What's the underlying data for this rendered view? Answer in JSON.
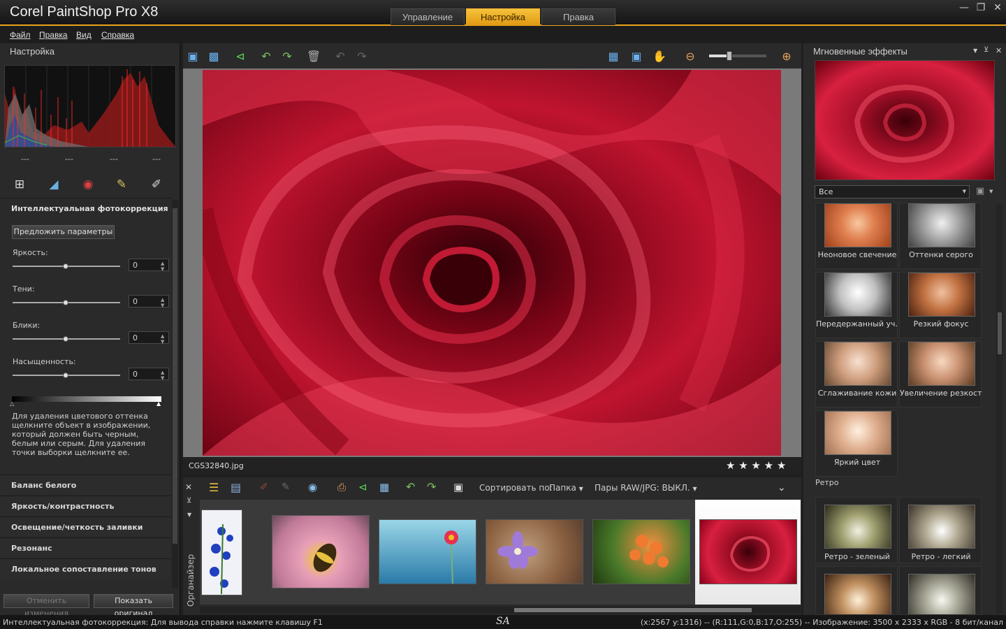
{
  "app": {
    "title": "Corel PaintShop Pro X8",
    "workspace_tabs": [
      "Управление",
      "Настройка",
      "Правка"
    ],
    "active_tab": "Настройка"
  },
  "menu": [
    "Файл",
    "Правка",
    "Вид",
    "Справка"
  ],
  "left_panel": {
    "title": "Настройка",
    "histogram_values": [
      "---",
      "---",
      "---",
      "---"
    ],
    "tools": [
      "crop-icon",
      "straighten-icon",
      "red-eye-icon",
      "retouch-icon",
      "makeover-icon"
    ],
    "smart_fix": {
      "title": "Интеллектуальная фотокоррекция",
      "suggest_button": "Предложить параметры",
      "sliders": [
        {
          "label": "Яркость:",
          "value": "0",
          "level": 0.5
        },
        {
          "label": "Тени:",
          "value": "0",
          "level": 0.5
        },
        {
          "label": "Блики:",
          "value": "0",
          "level": 0.5
        },
        {
          "label": "Насыщенность:",
          "value": "0",
          "level": 0.5
        }
      ],
      "help_text": "Для удаления цветового оттенка щелкните объект в изображении, который должен быть черным, белым или серым. Для удаления точки выборки щелкните ее."
    },
    "sections": [
      "Баланс белого",
      "Яркость/контрастность",
      "Освещение/четкость заливки",
      "Резонанс",
      "Локальное сопоставление тонов"
    ],
    "undo_button": "Отменить изменения",
    "show_original_button": "Показать оригинал"
  },
  "toolbar": {
    "icons": [
      "save-icon",
      "save-as-icon",
      "share-icon",
      "rotate-left-icon",
      "rotate-right-icon",
      "delete-icon",
      "undo-icon",
      "redo-icon"
    ],
    "view_icons": [
      "actual-size-icon",
      "fit-window-icon",
      "pan-hand-icon",
      "zoom-out-icon",
      "zoom-in-icon"
    ],
    "zoom_level": 0.35
  },
  "image": {
    "filename": "CGS32840.jpg",
    "rating_stars": "★ ★ ★ ★ ★"
  },
  "organizer": {
    "label": "Органайзер",
    "sort_label": "Сортировать по:",
    "sort_value": "Папка",
    "raw_pairs": "Пары RAW/JPG: ВЫКЛ.",
    "thumbnails": [
      "blue-flowers",
      "bee-on-flower",
      "gerbera-blue",
      "violet-flower",
      "orange-flowers",
      "red-rose"
    ]
  },
  "right_panel": {
    "title": "Мгновенные эффекты",
    "filter_value": "Все",
    "effects": [
      {
        "label": "Неоновое свечение",
        "tone": "warm"
      },
      {
        "label": "Оттенки серого",
        "tone": "gray"
      },
      {
        "label": "Передержанный уч...",
        "tone": "gray"
      },
      {
        "label": "Резкий фокус",
        "tone": "warm"
      },
      {
        "label": "Сглаживание кожи",
        "tone": "soft"
      },
      {
        "label": "Увеличение резкости",
        "tone": "warm"
      },
      {
        "label": "Яркий цвет",
        "tone": "soft"
      }
    ],
    "retro_category": "Ретро",
    "retro_effects": [
      {
        "label": "Ретро - зеленый"
      },
      {
        "label": "Ретро - легкий"
      }
    ]
  },
  "status": {
    "left": "Интеллектуальная фотокоррекция: Для вывода справки нажмите клавишу F1",
    "center": "SA",
    "right": "(x:2567 y:1316) -- (R:111,G:0,B:17,O:255) -- Изображение:  3500 x 2333 x RGB - 8 бит/канал"
  },
  "colors": {
    "accent": "#e8a31c",
    "rose_red": "#b3112a",
    "background": "#2a2a2a"
  }
}
